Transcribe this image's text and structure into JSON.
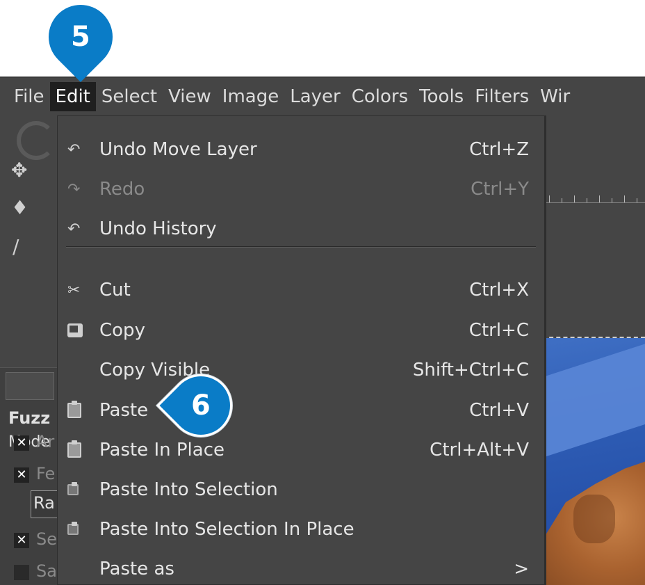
{
  "callouts": {
    "step_menu": "5",
    "step_item": "6"
  },
  "menubar": {
    "items": [
      "File",
      "Edit",
      "Select",
      "View",
      "Image",
      "Layer",
      "Colors",
      "Tools",
      "Filters",
      "Wir"
    ],
    "active": "Edit"
  },
  "tool_options": {
    "tool_name": "Fuzz",
    "mode_label": "Mode",
    "antialiasing": "Ar",
    "feather": "Fe",
    "radius": "Ra",
    "select_transparent": "Se",
    "sample_merged": "Sa"
  },
  "edit_menu": {
    "items": [
      {
        "label": "Undo Move Layer",
        "shortcut": "Ctrl+Z",
        "icon": "undo-icon",
        "enabled": true
      },
      {
        "label": "Redo",
        "shortcut": "Ctrl+Y",
        "icon": "redo-icon",
        "enabled": false
      },
      {
        "label": "Undo History",
        "shortcut": "",
        "icon": "undo-history-icon",
        "enabled": true
      },
      {
        "label": "Cut",
        "shortcut": "Ctrl+X",
        "icon": "scissors-icon",
        "enabled": true
      },
      {
        "label": "Copy",
        "shortcut": "Ctrl+C",
        "icon": "copy-icon",
        "enabled": true
      },
      {
        "label": "Copy Visible",
        "shortcut": "Shift+Ctrl+C",
        "icon": "",
        "enabled": true
      },
      {
        "label": "Paste",
        "shortcut": "Ctrl+V",
        "icon": "paste-icon",
        "enabled": true
      },
      {
        "label": "Paste In Place",
        "shortcut": "Ctrl+Alt+V",
        "icon": "paste-icon",
        "enabled": true
      },
      {
        "label": "Paste Into Selection",
        "shortcut": "",
        "icon": "paste-into-icon",
        "enabled": true
      },
      {
        "label": "Paste Into Selection In Place",
        "shortcut": "",
        "icon": "paste-into-icon",
        "enabled": true
      },
      {
        "label": "Paste as",
        "shortcut": ">",
        "icon": "",
        "enabled": true
      }
    ]
  },
  "colors": {
    "menu_bg": "#454545",
    "callout": "#0a7cc7",
    "active_menu": "#1f1f1f"
  }
}
